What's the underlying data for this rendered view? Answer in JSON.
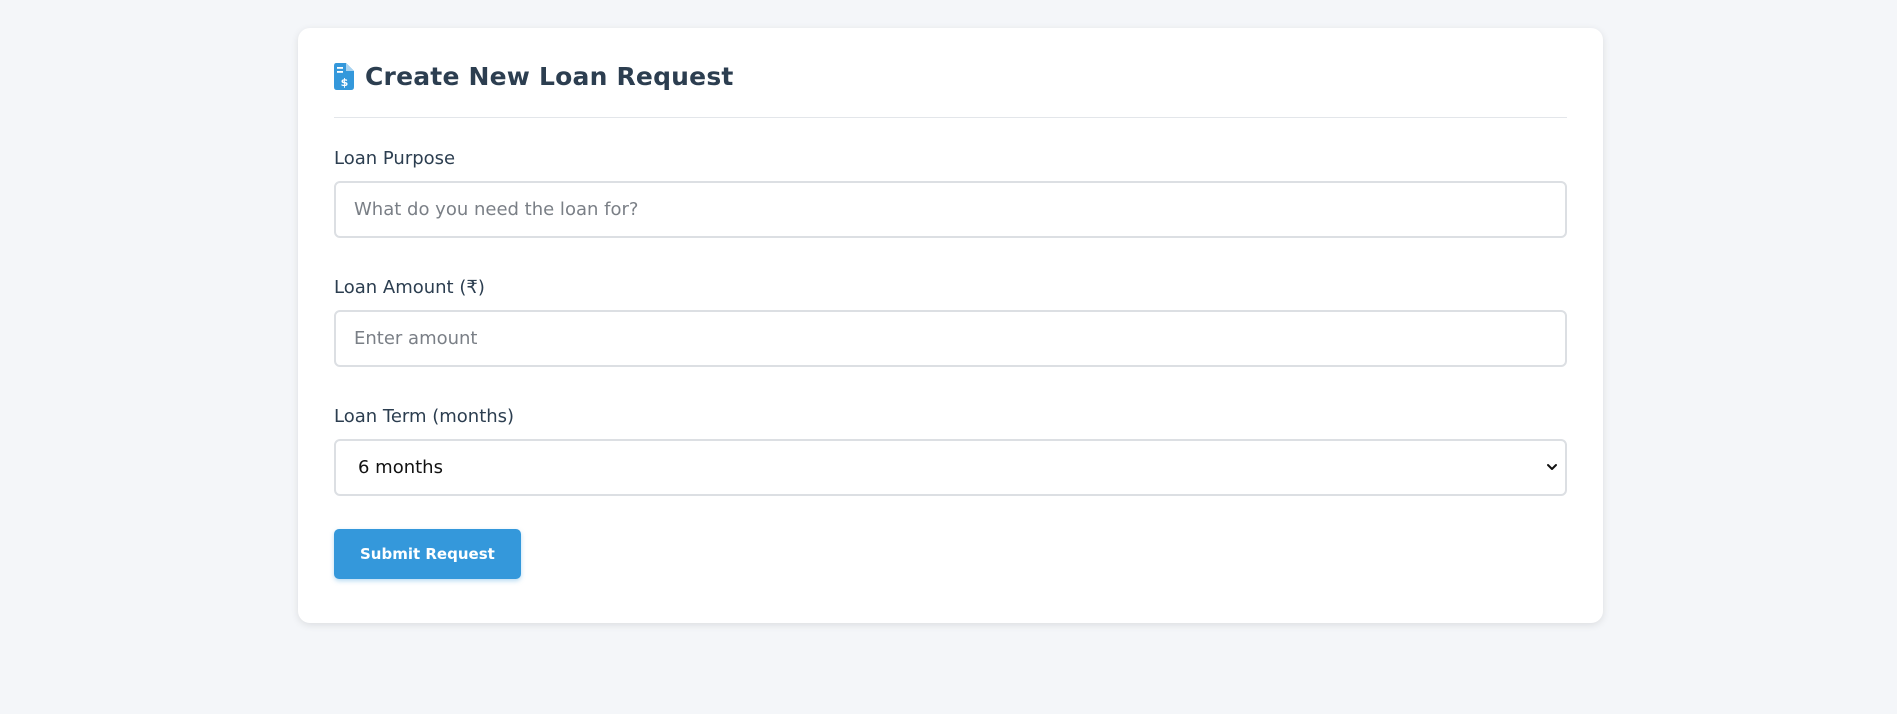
{
  "form": {
    "title": "Create New Loan Request",
    "icon": "file-invoice-dollar-icon",
    "accent_color": "#3498db",
    "title_color": "#2c3e50",
    "purpose": {
      "label": "Loan Purpose",
      "placeholder": "What do you need the loan for?",
      "value": ""
    },
    "amount": {
      "label": "Loan Amount (₹)",
      "placeholder": "Enter amount",
      "value": ""
    },
    "term": {
      "label": "Loan Term (months)",
      "selected": "6 months"
    },
    "submit_label": "Submit Request"
  }
}
